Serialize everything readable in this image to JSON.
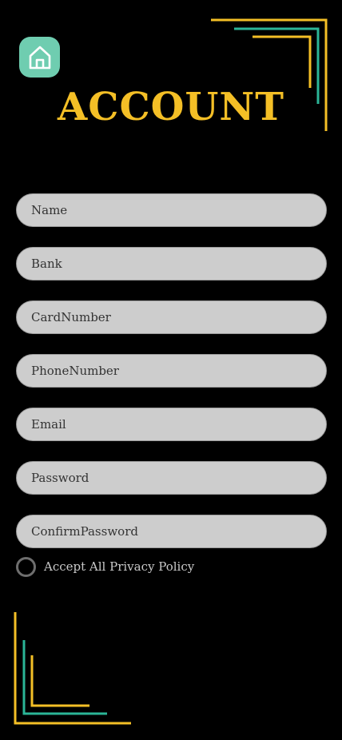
{
  "header": {
    "home_icon": "home-icon",
    "title": "ACCOUNT"
  },
  "form": {
    "fields": [
      {
        "name": "name-field",
        "placeholder": "Name",
        "value": ""
      },
      {
        "name": "bank-field",
        "placeholder": "Bank",
        "value": ""
      },
      {
        "name": "card-number-field",
        "placeholder": "CardNumber",
        "value": ""
      },
      {
        "name": "phone-number-field",
        "placeholder": "PhoneNumber",
        "value": ""
      },
      {
        "name": "email-field",
        "placeholder": "Email",
        "value": ""
      },
      {
        "name": "password-field",
        "placeholder": "Password",
        "value": ""
      },
      {
        "name": "confirm-password-field",
        "placeholder": "ConfirmPassword",
        "value": ""
      }
    ],
    "policy_label": "Accept All Privacy Policy",
    "policy_checked": false
  },
  "colors": {
    "background": "#000000",
    "accent_yellow": "#f4bf26",
    "accent_teal": "#2bb597",
    "home_button": "#6fcdb0",
    "field_fill": "#cdcdcd",
    "field_text": "#333333",
    "radio_border": "#6e6e6e"
  }
}
